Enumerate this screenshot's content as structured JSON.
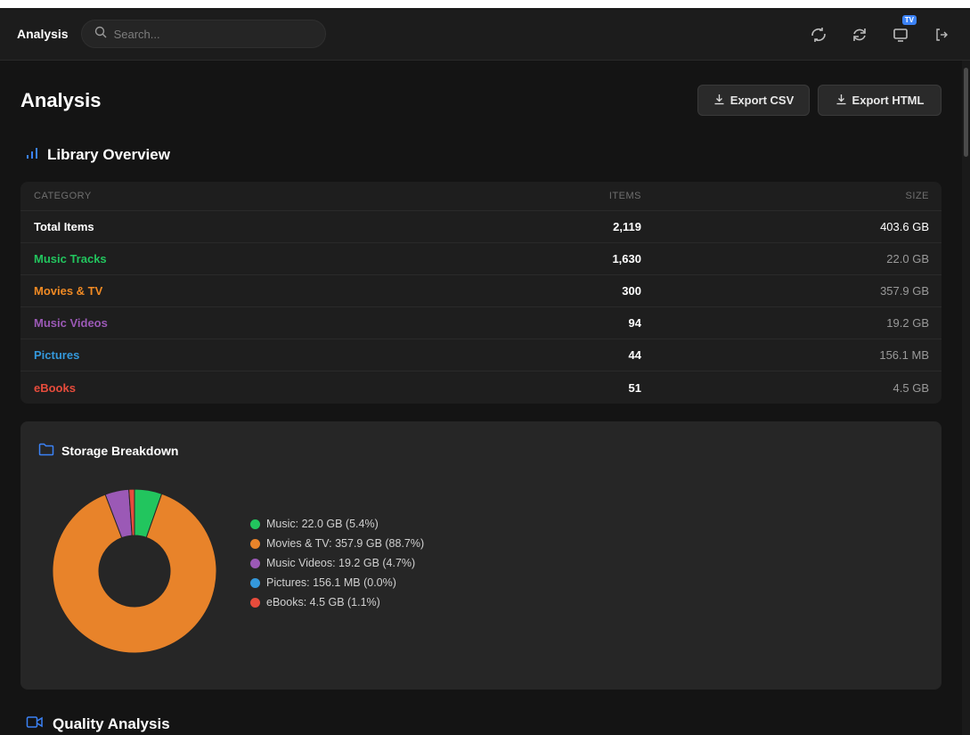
{
  "header": {
    "app_title": "Analysis",
    "search_placeholder": "Search...",
    "tv_badge": "TV"
  },
  "page": {
    "title": "Analysis",
    "export_csv": "Export CSV",
    "export_html": "Export HTML"
  },
  "overview": {
    "title": "Library Overview",
    "columns": [
      "CATEGORY",
      "ITEMS",
      "SIZE"
    ],
    "rows": [
      {
        "category": "Total Items",
        "items": "2,119",
        "size": "403.6 GB",
        "color": "#ffffff"
      },
      {
        "category": "Music Tracks",
        "items": "1,630",
        "size": "22.0 GB",
        "color": "#22c55e"
      },
      {
        "category": "Movies & TV",
        "items": "300",
        "size": "357.9 GB",
        "color": "#f08a24"
      },
      {
        "category": "Music Videos",
        "items": "94",
        "size": "19.2 GB",
        "color": "#9b59b6"
      },
      {
        "category": "Pictures",
        "items": "44",
        "size": "156.1 MB",
        "color": "#3498db"
      },
      {
        "category": "eBooks",
        "items": "51",
        "size": "4.5 GB",
        "color": "#e74c3c"
      }
    ]
  },
  "storage": {
    "title": "Storage Breakdown",
    "legend": [
      {
        "label": "Music: 22.0 GB (5.4%)",
        "color": "#22c55e"
      },
      {
        "label": "Movies & TV: 357.9 GB (88.7%)",
        "color": "#e8832a"
      },
      {
        "label": "Music Videos: 19.2 GB (4.7%)",
        "color": "#9b59b6"
      },
      {
        "label": "Pictures: 156.1 MB (0.0%)",
        "color": "#3498db"
      },
      {
        "label": "eBooks: 4.5 GB (1.1%)",
        "color": "#e74c3c"
      }
    ]
  },
  "chart_data": {
    "type": "pie",
    "categories": [
      "Music",
      "Movies & TV",
      "Music Videos",
      "Pictures",
      "eBooks"
    ],
    "values": [
      5.4,
      88.7,
      4.7,
      0.0,
      1.1
    ],
    "colors": [
      "#22c55e",
      "#e8832a",
      "#9b59b6",
      "#3498db",
      "#e74c3c"
    ]
  },
  "quality": {
    "title": "Quality Analysis"
  }
}
